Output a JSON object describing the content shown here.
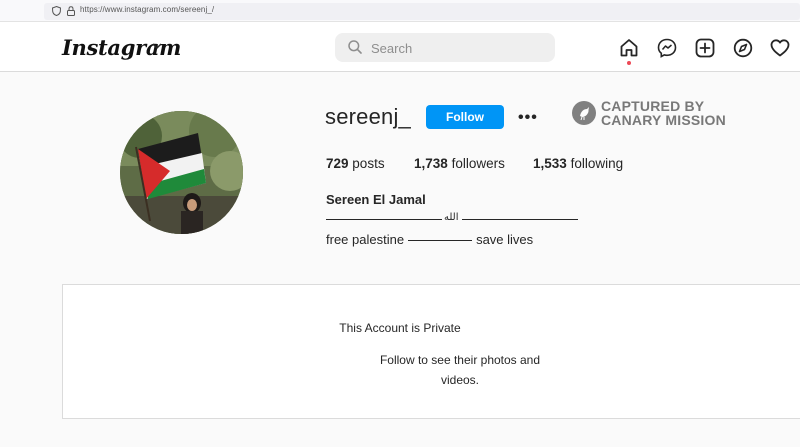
{
  "browser": {
    "url": "https://www.instagram.com/sereenj_/"
  },
  "nav": {
    "logo": "Instagram",
    "search_placeholder": "Search",
    "icons": [
      "home-icon",
      "messenger-icon",
      "new-post-icon",
      "explore-icon",
      "activity-heart-icon"
    ],
    "notification_dot_color": "#ed4956"
  },
  "profile": {
    "username": "sereenj_",
    "follow_label": "Follow",
    "more_label": "•••",
    "stats": {
      "posts_count": "729",
      "posts_label": "posts",
      "followers_count": "1,738",
      "followers_label": "followers",
      "following_count": "1,533",
      "following_label": "following"
    },
    "full_name": "Sereen El Jamal",
    "bio_line1_word": "الله",
    "bio_line2_start": "free palestine",
    "bio_line2_end": "save lives"
  },
  "watermark": {
    "line1": "CAPTURED BY",
    "line2": "CANARY MISSION"
  },
  "private_notice": {
    "title": "This Account is Private",
    "subtitle": "Follow to see their photos and videos."
  },
  "colors": {
    "follow_button": "#0095f6",
    "page_background": "#fafafa",
    "watermark": "#6b6b6b"
  }
}
